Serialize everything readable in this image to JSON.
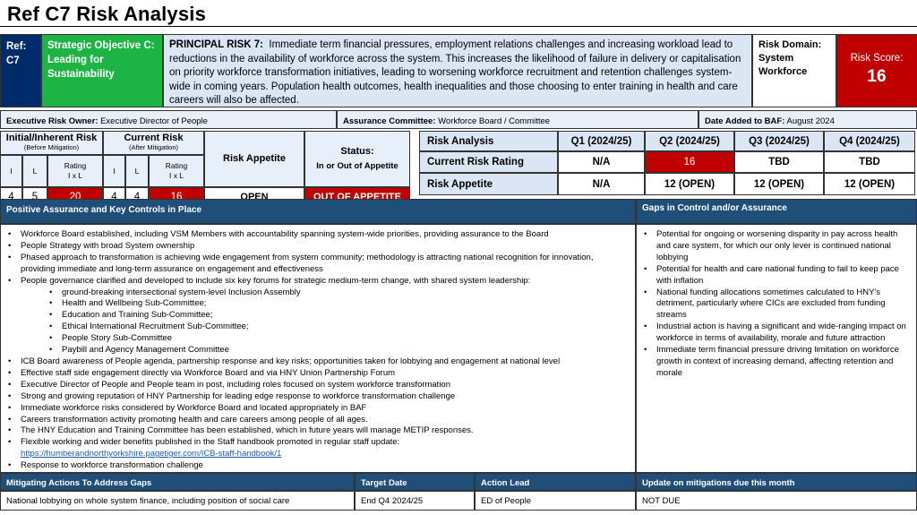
{
  "title": "Ref C7   Risk Analysis",
  "ref": {
    "label": "Ref:",
    "value": "C7"
  },
  "objective": "Strategic Objective C: Leading for Sustainability",
  "principal": {
    "label": "PRINCIPAL RISK 7:",
    "text": "Immediate term financial pressures, employment relations challenges and increasing workload lead to reductions in the availability of workforce across the system. This increases the likelihood of failure in delivery or capitalisation on priority workforce transformation initiatives, leading to worsening workforce recruitment and retention challenges system-wide in coming years. Population health outcomes, health inequalities and those choosing to enter training in health and care careers will also be affected."
  },
  "domain": {
    "label": "Risk Domain:",
    "value": "System Workforce"
  },
  "score": {
    "label": "Risk Score:",
    "value": "16"
  },
  "meta": {
    "owner_label": "Executive Risk Owner:",
    "owner": "Executive Director of People",
    "committee_label": "Assurance Committee:",
    "committee": "Workforce Board /  Committee",
    "date_label": "Date Added to BAF:",
    "date": "August 2024"
  },
  "rating": {
    "initial_title": "Initial/Inherent Risk",
    "initial_sub": "(Before Mitigation)",
    "current_title": "Current Risk",
    "current_sub": "(After Mitigation)",
    "col_i": "I",
    "col_l": "L",
    "col_rating": "Rating",
    "col_rating_sub": "I x L",
    "appetite_label": "Risk Appetite",
    "status_label": "Status:",
    "status_sub": "In or Out of Appetite",
    "initial": {
      "i": "4",
      "l": "5",
      "rating": "20"
    },
    "current": {
      "i": "4",
      "l": "4",
      "rating": "16"
    },
    "appetite": "OPEN",
    "status": "OUT OF APPETITE"
  },
  "analysis": {
    "header": "Risk Analysis",
    "quarters": [
      "Q1 (2024/25)",
      "Q2 (2024/25)",
      "Q3 (2024/25)",
      "Q4 (2024/25)"
    ],
    "rows": [
      {
        "label": "Current Risk Rating",
        "values": [
          "N/A",
          "16",
          "TBD",
          "TBD"
        ]
      },
      {
        "label": "Risk Appetite",
        "values": [
          "N/A",
          "12 (OPEN)",
          "12 (OPEN)",
          "12 (OPEN)"
        ]
      }
    ]
  },
  "assurance": {
    "header": "Positive Assurance and Key Controls in Place",
    "items": [
      "Workforce Board established, including VSM Members with accountability spanning system-wide priorities, providing assurance to the Board",
      "People Strategy with broad System ownership",
      "Phased approach to transformation is achieving wide engagement from system community; methodology is attracting national recognition for innovation, providing immediate and long-term assurance on engagement and effectiveness",
      "People governance clarified and developed to include six key forums for strategic medium-term change, with shared system leadership:"
    ],
    "subitems": [
      "ground-breaking intersectional system-level Inclusion Assembly",
      "Health and Wellbeing Sub-Committee;",
      "Education and Training Sub-Committee;",
      "Ethical International Recruitment Sub-Committee;",
      "People Story Sub-Committee",
      "Paybill and Agency Management Committee"
    ],
    "items2": [
      "ICB Board awareness of People agenda, partnership response and key risks; opportunities taken for lobbying and engagement at national level",
      "Effective staff side engagement directly via Workforce Board and via HNY Union Partnership Forum",
      "Executive Director of People and People team in post, including roles focused on system workforce transformation",
      "Strong and growing reputation of HNY Partnership for leading edge response to workforce transformation challenge",
      "Immediate workforce risks considered by Workforce Board and located appropriately in BAF",
      "Careers transformation activity promoting health and care careers among people of all ages.",
      "The HNY Education and Training Committee has been established, which in future years will manage METIP responses."
    ],
    "flex_item": "Flexible working and wider benefits published in the Staff handbook promoted in regular staff update:",
    "flex_link": "https://humberandnorthyorkshire.pagetiger.com/ICB-staff-handbook/1",
    "last_item": "Response to workforce transformation challenge"
  },
  "gaps": {
    "header": "Gaps in Control and/or Assurance",
    "items": [
      "Potential for ongoing or worsening disparity in pay across health and care system, for which our only lever is continued national lobbying",
      "Potential for health and care national funding to fail to keep pace with inflation",
      "National funding allocations sometimes calculated to HNY's detriment, particularly where CICs are excluded from funding streams",
      "Industrial action is having a significant and wide-ranging impact on workforce in terms of availability, morale and future attraction",
      "Immediate term financial pressure driving limitation on workforce growth in context of increasing demand, affecting retention and morale"
    ]
  },
  "mitigation": {
    "headers": {
      "actions": "Mitigating Actions To Address Gaps",
      "target": "Target Date",
      "lead": "Action Lead",
      "update": "Update on mitigations due this month"
    },
    "row": {
      "actions": "National lobbying on whole system finance, including position of social care",
      "target": "End Q4 2024/25",
      "lead": "ED of People",
      "update": "NOT DUE"
    }
  },
  "colors": {
    "navy": "#002b6b",
    "green": "#1db345",
    "red": "#c00000",
    "header_blue": "#1f4e79",
    "light_blue": "#dbe6f4"
  }
}
